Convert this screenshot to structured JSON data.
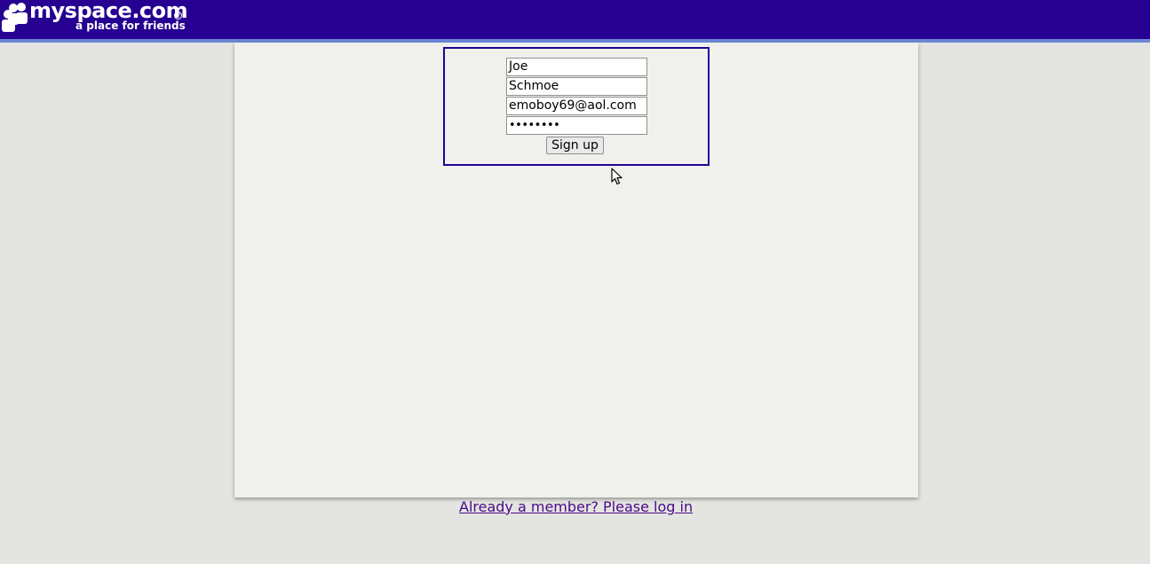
{
  "header": {
    "logo_text": "myspace.com",
    "logo_tagline": "a place for friends",
    "logo_registered": "®",
    "background_color": "#260191",
    "accent_color": "#6b86d6"
  },
  "signup_form": {
    "first_name_value": "Joe",
    "last_name_value": "Schmoe",
    "email_value": "emoboy69@aol.com",
    "password_display": "••••••••",
    "submit_label": "Sign up",
    "border_color": "#260191"
  },
  "footer": {
    "login_link": "Already a member? Please log in",
    "link_color": "#4a0a8a"
  },
  "icons": {
    "logo": "people-silhouette-icon",
    "cursor": "mouse-pointer-icon"
  }
}
